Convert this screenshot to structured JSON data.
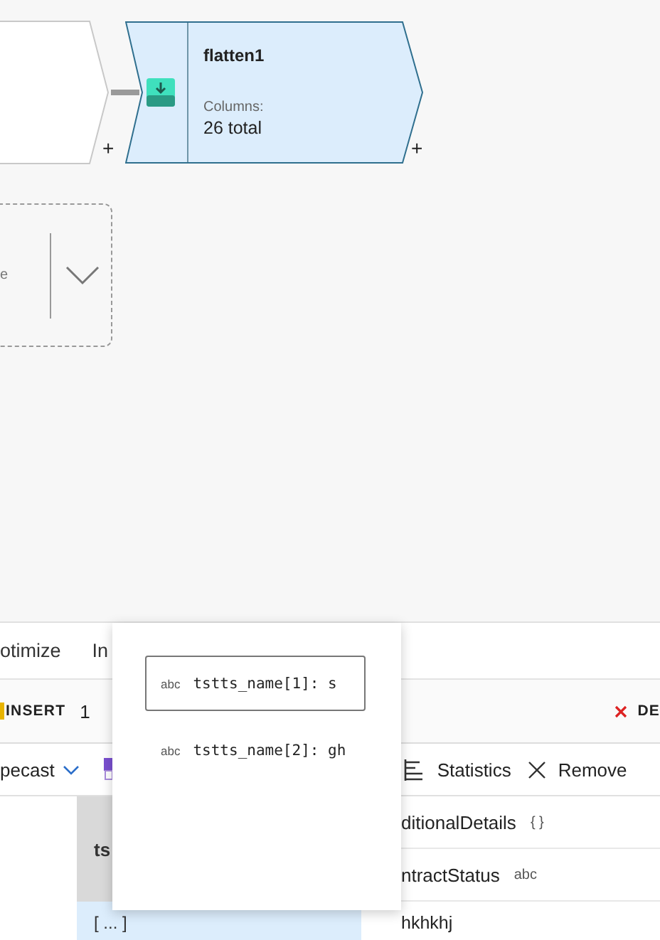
{
  "canvas": {
    "nodes": [
      {
        "kind": "partial",
        "plus": "+"
      },
      {
        "kind": "flatten",
        "title": "flatten1",
        "columns_label": "Columns:",
        "columns_value": "26 total",
        "plus": "+"
      }
    ],
    "pending_node": {
      "label_fragment": "e"
    }
  },
  "panel": {
    "tabs": [
      {
        "label": "otimize",
        "selected": false
      },
      {
        "label": "In",
        "selected": false
      }
    ],
    "summary": {
      "insert_label": "INSERT",
      "insert_count": "1",
      "delete_label": "DE"
    },
    "toolbar": [
      {
        "kind": "dropdown",
        "label": "pecast"
      },
      {
        "kind": "partial-icon"
      },
      {
        "kind": "statistics",
        "label": "Statistics"
      },
      {
        "kind": "remove",
        "label": "Remove"
      }
    ],
    "grid": {
      "selected_column": {
        "header": "ts",
        "cell": "[ ... ]",
        "selected": true
      },
      "right_column": {
        "headers": [
          {
            "label": "ditionalDetails",
            "type_badge": "{ }"
          },
          {
            "label": "ntractStatus",
            "type_badge": "abc"
          }
        ],
        "cell": "hkhkhj"
      }
    }
  },
  "popup": {
    "items": [
      {
        "type_badge": "abc",
        "text": "tstts_name[1]: s",
        "selected": true
      },
      {
        "type_badge": "abc",
        "text": "tstts_name[2]: gh",
        "selected": false
      }
    ]
  }
}
